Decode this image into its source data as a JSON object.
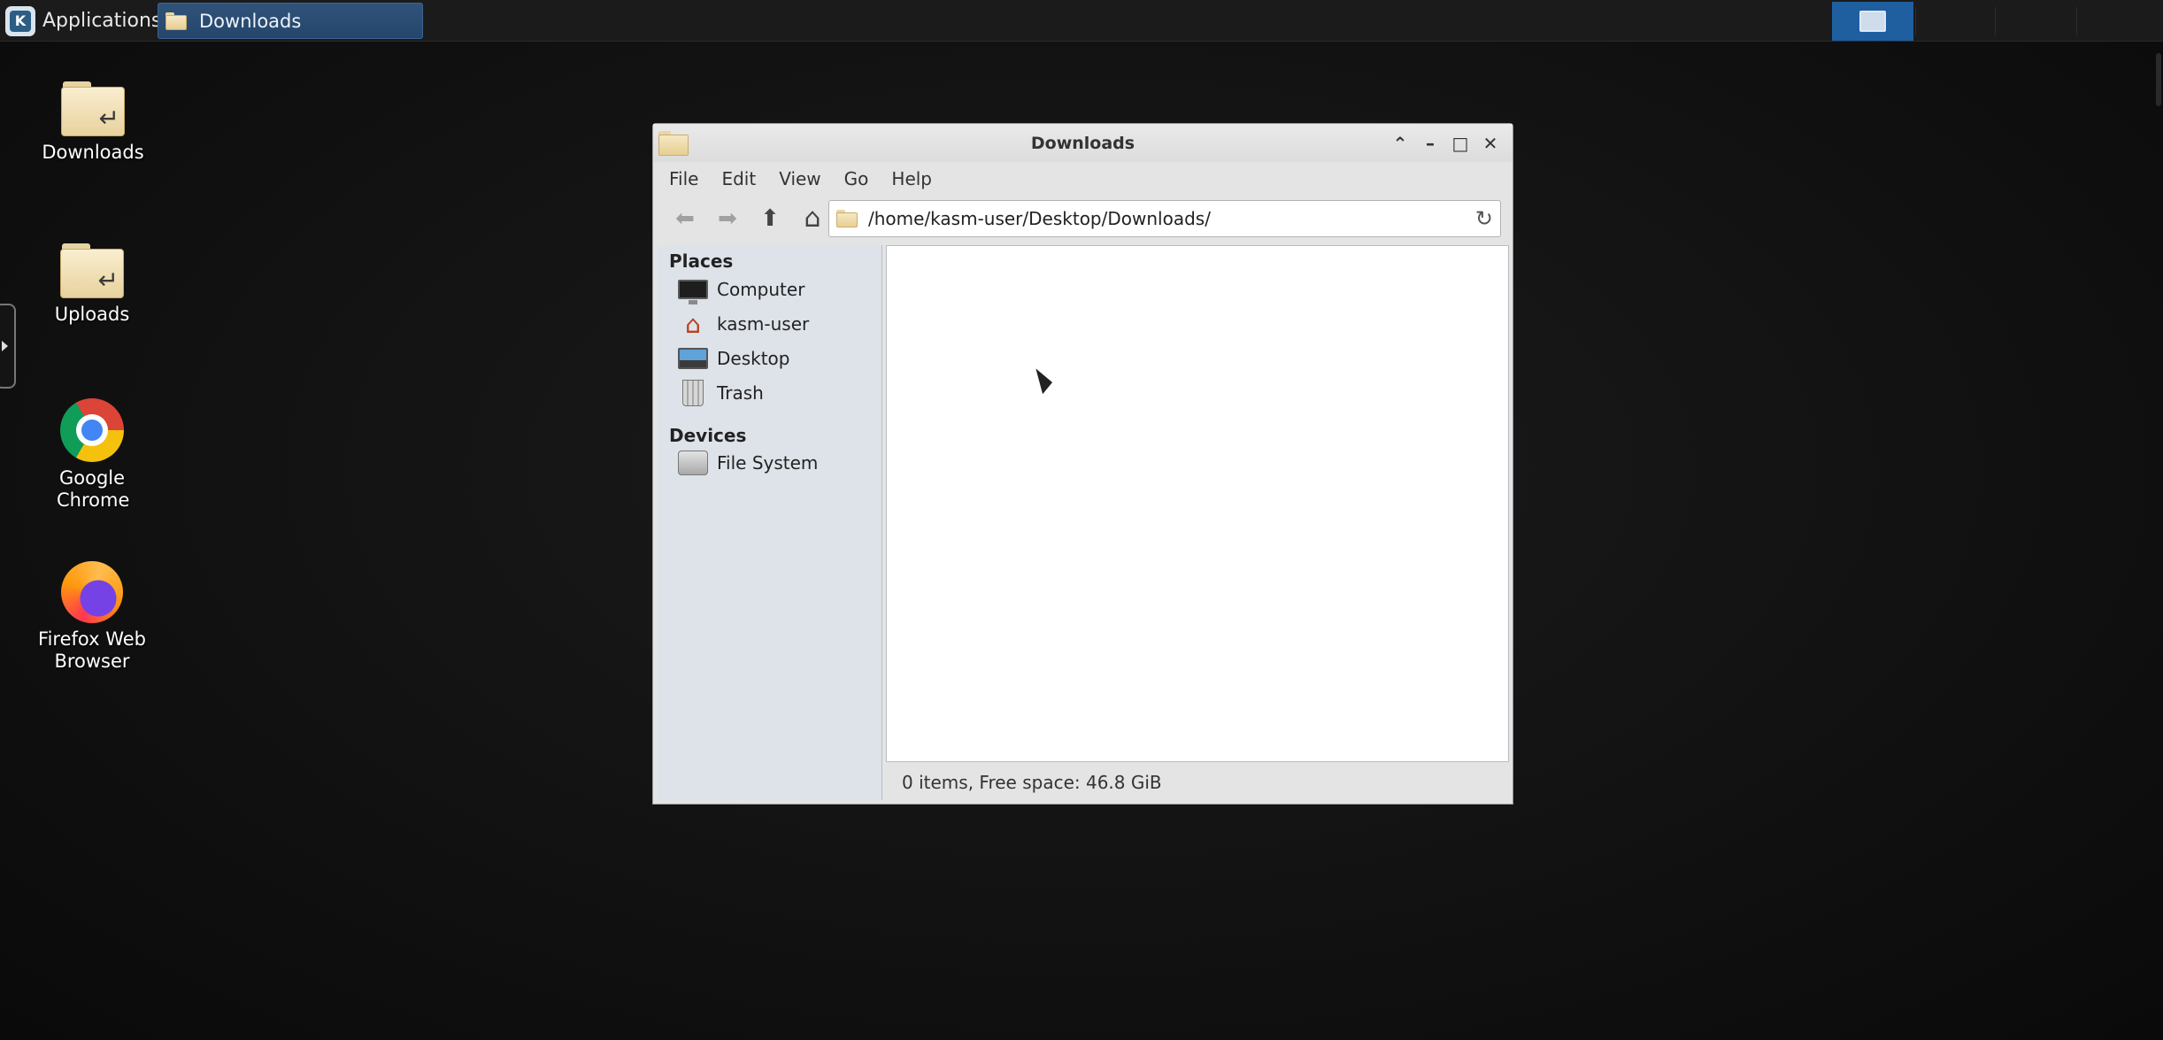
{
  "panel": {
    "apps_label": "Applications",
    "apps_separator": "≡",
    "task_label": "Downloads"
  },
  "desktop_icons": [
    {
      "label": "Downloads"
    },
    {
      "label": "Uploads"
    },
    {
      "label": "Google Chrome"
    },
    {
      "label": "Firefox Web Browser"
    }
  ],
  "window": {
    "title": "Downloads",
    "controls": {
      "shade": "⌃",
      "minimize": "–",
      "maximize": "□",
      "close": "✕"
    },
    "menus": [
      "File",
      "Edit",
      "View",
      "Go",
      "Help"
    ],
    "toolbar": {
      "back": "🡸",
      "forward": "🡺",
      "up": "🡹",
      "home": "⌂"
    },
    "location": "/home/kasm-user/Desktop/Downloads/",
    "sidebar": {
      "places_heading": "Places",
      "places": [
        "Computer",
        "kasm-user",
        "Desktop",
        "Trash"
      ],
      "devices_heading": "Devices",
      "devices": [
        "File System"
      ]
    },
    "status": "0 items, Free space: 46.8 GiB"
  },
  "colors": {
    "accent": "#1f5fa0",
    "task_button": "#24466c",
    "sidebar_bg": "#dee3ea"
  }
}
